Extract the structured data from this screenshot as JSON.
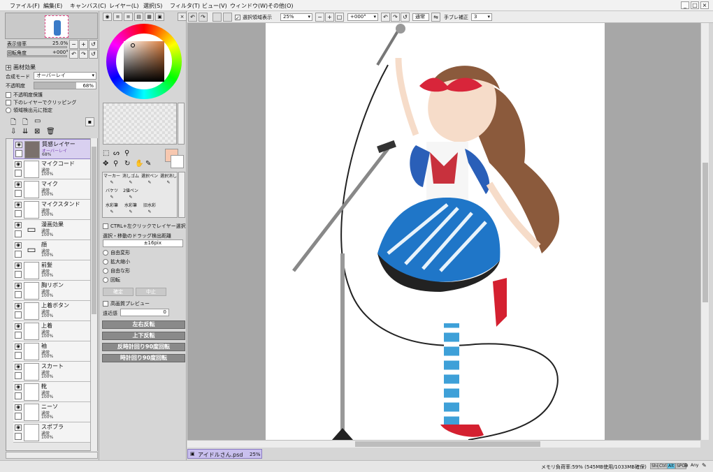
{
  "menu": {
    "items": [
      "ファイル(F)",
      "編集(E)",
      "キャンバス(C)",
      "レイヤー(L)",
      "選択(S)",
      "フィルタ(T)",
      "ビュー(V)",
      "ウィンドウ(W)",
      "その他(O)"
    ]
  },
  "navigator": {
    "zoom_label": "表示倍率",
    "zoom_value": "25.0%",
    "rotate_label": "回転角度",
    "rotate_value": "+000°"
  },
  "effects": {
    "title": "画材効果"
  },
  "layer_props": {
    "blend_label": "合成モード",
    "blend_value": "オーバーレイ",
    "opacity_label": "不透明度",
    "opacity_value": "68%",
    "opts": [
      "不透明度保護",
      "下のレイヤーでクリッピング",
      "領域検出元に指定"
    ]
  },
  "layers": [
    {
      "name": "質感レイヤー",
      "mode": "オーバーレイ",
      "opacity": "68%",
      "selected": true,
      "thumb": "#7a706c"
    },
    {
      "name": "マイクコード",
      "mode": "通常",
      "opacity": "100%",
      "thumb": "#ffffff"
    },
    {
      "name": "マイク",
      "mode": "通常",
      "opacity": "100%",
      "thumb": "#ffffff"
    },
    {
      "name": "マイクスタンド",
      "mode": "通常",
      "opacity": "100%",
      "thumb": "#ffffff"
    },
    {
      "name": "漫画効果",
      "mode": "通常",
      "opacity": "100%",
      "folder": true
    },
    {
      "name": "顔",
      "mode": "通常",
      "opacity": "100%",
      "folder": true
    },
    {
      "name": "前髪",
      "mode": "通常",
      "opacity": "100%",
      "thumb": "#ffffff"
    },
    {
      "name": "胸リボン",
      "mode": "通常",
      "opacity": "100%",
      "thumb": "#ffffff"
    },
    {
      "name": "上着ボタン",
      "mode": "通常",
      "opacity": "100%",
      "thumb": "#ffffff"
    },
    {
      "name": "上着",
      "mode": "通常",
      "opacity": "100%",
      "thumb": "#ffffff"
    },
    {
      "name": "袖",
      "mode": "通常",
      "opacity": "100%",
      "thumb": "#ffffff"
    },
    {
      "name": "スカート",
      "mode": "通常",
      "opacity": "100%",
      "thumb": "#ffffff"
    },
    {
      "name": "靴",
      "mode": "通常",
      "opacity": "100%",
      "thumb": "#ffffff"
    },
    {
      "name": "ニーソ",
      "mode": "通常",
      "opacity": "100%",
      "thumb": "#ffffff"
    },
    {
      "name": "スポブラ",
      "mode": "通常",
      "opacity": "100%",
      "thumb": "#ffffff"
    }
  ],
  "tools": [
    {
      "name": "マーカー"
    },
    {
      "name": "消しゴム"
    },
    {
      "name": "選択ペン"
    },
    {
      "name": "選択消し"
    },
    {
      "name": "バケツ"
    },
    {
      "name": "2値ペン"
    },
    {
      "name": ""
    },
    {
      "name": ""
    },
    {
      "name": "水彩筆"
    },
    {
      "name": "水彩筆"
    },
    {
      "name": "旧水彩"
    },
    {
      "name": ""
    }
  ],
  "tool_options": {
    "ctrl_click": "CTRL+左クリックでレイヤー選択",
    "drag_label": "選択・移動のドラッグ検出距離",
    "drag_value": "±16pix",
    "transforms": [
      "自由変形",
      "拡大縮小",
      "自由な形",
      "回転"
    ],
    "ok": "確定",
    "cancel": "中止",
    "hq_preview": "高画質プレビュー",
    "perspective_label": "遠近感",
    "perspective_value": "0",
    "flip_h": "左右反転",
    "flip_v": "上下反転",
    "rot_ccw": "反時計回り90度回転",
    "rot_cw": "時計回り90度回転"
  },
  "canvas_toolbar": {
    "show_selection": "選択領域表示",
    "zoom": "25%",
    "angle": "+000°",
    "blend": "通常",
    "stabilizer_label": "手ブレ補正",
    "stabilizer_value": "3"
  },
  "document_tab": {
    "name": "アイドルさん.psd",
    "zoom": "25%"
  },
  "status": {
    "memory": "メモリ負荷率:59% (545MB使用/1033MB確保)",
    "keys": [
      "Shift",
      "Ctrl",
      "Alt",
      "SPC",
      "Any"
    ]
  },
  "colors": {
    "accent": "#8c7cc4",
    "canvas_bg": "#a7a7a7",
    "swatch": "#f7c8b0"
  }
}
